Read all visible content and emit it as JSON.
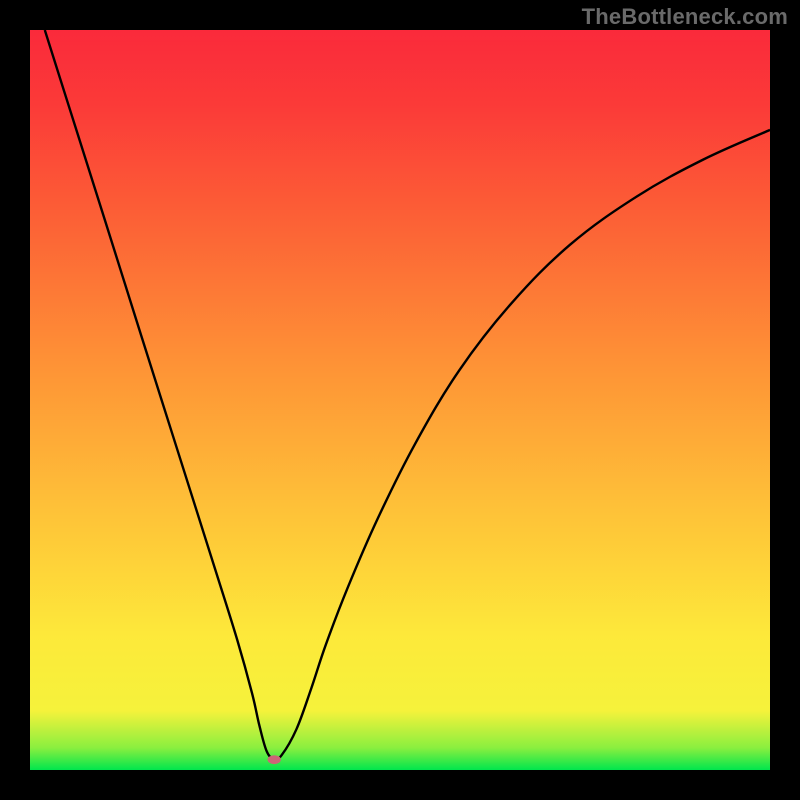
{
  "watermark": "TheBottleneck.com",
  "chart_data": {
    "type": "line",
    "title": "",
    "xlabel": "",
    "ylabel": "",
    "xlim": [
      0,
      1
    ],
    "ylim": [
      0,
      1
    ],
    "gradient_stops": [
      {
        "offset": 0.0,
        "color": "#00e64d"
      },
      {
        "offset": 0.03,
        "color": "#8aef3f"
      },
      {
        "offset": 0.08,
        "color": "#f5f23b"
      },
      {
        "offset": 0.18,
        "color": "#fde93a"
      },
      {
        "offset": 0.35,
        "color": "#fec238"
      },
      {
        "offset": 0.55,
        "color": "#fe9236"
      },
      {
        "offset": 0.75,
        "color": "#fc5f36"
      },
      {
        "offset": 0.9,
        "color": "#fb3a38"
      },
      {
        "offset": 1.0,
        "color": "#fa2a3b"
      }
    ],
    "curve": {
      "x": [
        0.02,
        0.05,
        0.1,
        0.15,
        0.2,
        0.25,
        0.28,
        0.3,
        0.31,
        0.32,
        0.33,
        0.34,
        0.36,
        0.38,
        0.4,
        0.43,
        0.47,
        0.52,
        0.58,
        0.65,
        0.73,
        0.82,
        0.91,
        1.0
      ],
      "y": [
        1.0,
        0.905,
        0.747,
        0.588,
        0.43,
        0.272,
        0.176,
        0.104,
        0.06,
        0.025,
        0.015,
        0.02,
        0.055,
        0.11,
        0.17,
        0.248,
        0.34,
        0.44,
        0.54,
        0.63,
        0.71,
        0.775,
        0.825,
        0.865
      ]
    },
    "marker": {
      "x": 0.33,
      "y": 0.014,
      "rx": 0.009,
      "ry": 0.006,
      "color": "#cc6677"
    }
  }
}
